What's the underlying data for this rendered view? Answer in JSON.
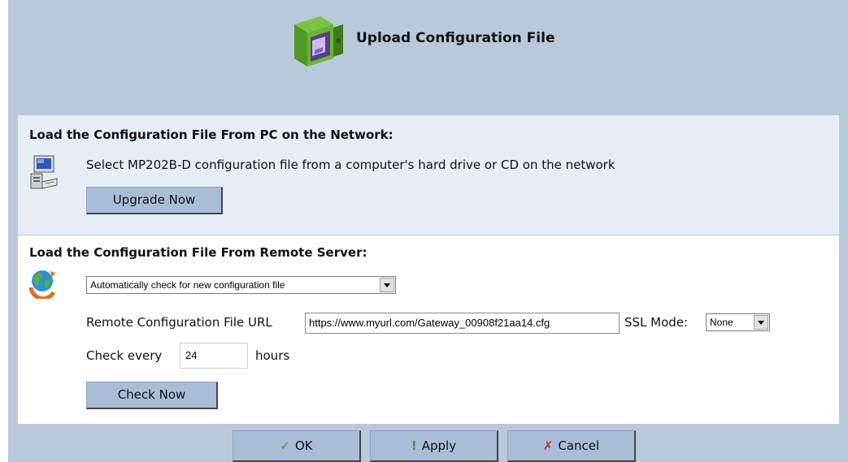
{
  "header": {
    "title": "Upload Configuration File",
    "icon": "safe-icon"
  },
  "pc_section": {
    "title": "Load the Configuration File From PC on the Network:",
    "description": "Select MP202B-D configuration file from a computer's hard drive or CD on the network",
    "button_label": "Upgrade Now",
    "icon": "computer-icon"
  },
  "remote_section": {
    "title": "Load the Configuration File From Remote Server:",
    "icon": "globe-icon",
    "mode_select": "Automatically check for new configuration file",
    "url_label": "Remote Configuration File URL",
    "url_value": "https://www.myurl.com/Gateway_00908f21aa14.cfg",
    "ssl_label": "SSL Mode:",
    "ssl_select": "None",
    "check_label": "Check every",
    "check_value": "24",
    "hours_label": "hours",
    "check_button": "Check Now"
  },
  "footer": {
    "ok_label": "OK",
    "apply_label": "Apply",
    "cancel_label": "Cancel",
    "ok_glyph": "✓",
    "apply_glyph": "!",
    "cancel_glyph": "✗"
  },
  "colors": {
    "frame_bg": "#b9c9dc",
    "section_pc_bg": "#e6edf5",
    "button_bg": "#a9bdd7"
  }
}
